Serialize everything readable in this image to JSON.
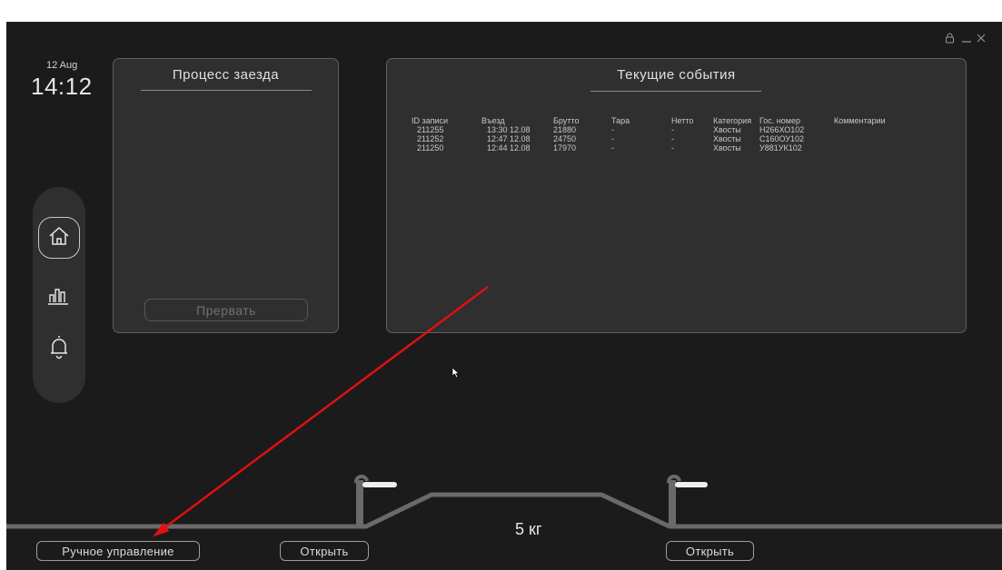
{
  "clock": {
    "date": "12 Aug",
    "time": "14:12"
  },
  "window_controls": [
    "lock-icon",
    "minimize-icon",
    "close-icon"
  ],
  "nav": {
    "items": [
      "home-icon",
      "stats-icon",
      "bell-icon"
    ],
    "active": "home-icon"
  },
  "race_panel": {
    "title": "Процесс заезда",
    "abort_label": "Прервать"
  },
  "events_panel": {
    "title": "Текущие события",
    "columns": [
      "ID записи",
      "Въезд",
      "Брутто",
      "Тара",
      "Нетто",
      "Категория",
      "Гос. номер",
      "Комментарии"
    ],
    "rows": [
      [
        "211255",
        "13:30 12.08",
        "21880",
        "-",
        "-",
        "Хвосты",
        "Н266ХО102",
        ""
      ],
      [
        "211252",
        "12:47 12.08",
        "24750",
        "-",
        "-",
        "Хвосты",
        "С160ОУ102",
        ""
      ],
      [
        "211250",
        "12:44 12.08",
        "17970",
        "-",
        "-",
        "Хвосты",
        "У881УК102",
        ""
      ]
    ]
  },
  "scale": {
    "weight": "5 кг"
  },
  "controls": {
    "manual_label": "Ручное управление",
    "open_label_1": "Открыть",
    "open_label_2": "Открыть"
  },
  "colors": {
    "background": "#1b1b1b",
    "panel": "#2f2f2f",
    "annotation_arrow": "#e01010"
  }
}
